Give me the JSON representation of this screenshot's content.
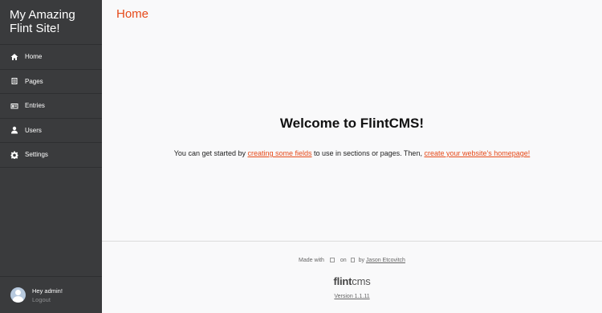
{
  "sidebar": {
    "site_title": "My Amazing Flint Site!",
    "items": [
      {
        "label": "Home",
        "icon": "home-icon"
      },
      {
        "label": "Pages",
        "icon": "page-icon"
      },
      {
        "label": "Entries",
        "icon": "entries-icon"
      },
      {
        "label": "Users",
        "icon": "user-icon"
      },
      {
        "label": "Settings",
        "icon": "gear-icon"
      }
    ]
  },
  "user": {
    "greeting": "Hey admin!",
    "logout": "Logout"
  },
  "main": {
    "page_title": "Home",
    "welcome_title": "Welcome to FlintCMS!",
    "intro_before": "You can get started by ",
    "link_fields": "creating some fields",
    "intro_middle": " to use in sections or pages. Then, ",
    "link_homepage": "create your website's homepage!"
  },
  "footer": {
    "made_with": "Made with",
    "on": "on",
    "by": "by",
    "author": "Jason Etcovitch",
    "logo_bold": "flint",
    "logo_light": "cms",
    "version": "Version 1.1.11"
  },
  "colors": {
    "accent": "#e64a19",
    "sidebar_bg": "#3a3b3d",
    "main_bg": "#f9f9fa"
  }
}
